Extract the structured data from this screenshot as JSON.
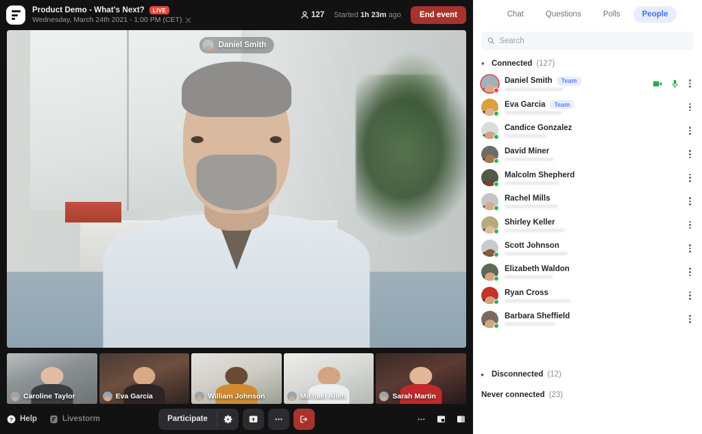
{
  "header": {
    "logo_icon": "livestorm-logo-icon",
    "event_title": "Product Demo - What's Next?",
    "live_badge": "LIVE",
    "event_date": "Wednesday, March 24th 2021 - 1:00 PM (CET)",
    "shuffle_icon": "shuffle-icon",
    "attendee_icon": "person-icon",
    "attendee_count": "127",
    "started_prefix": "Started",
    "started_duration": "1h 23m",
    "started_suffix": "ago",
    "end_event_label": "End event"
  },
  "stage": {
    "active_speaker": "Daniel Smith",
    "thumbnails": [
      {
        "name": "Caroline Taylor"
      },
      {
        "name": "Eva Garcia"
      },
      {
        "name": "William Johnson"
      },
      {
        "name": "Michael Allen"
      },
      {
        "name": "Sarah Martin"
      }
    ]
  },
  "bottom_bar": {
    "help_label": "Help",
    "help_icon": "question-circle-icon",
    "brand_label": "Livestorm",
    "brand_icon": "livestorm-logo-icon",
    "participate_label": "Participate",
    "settings_icon": "gear-icon",
    "share_icon": "share-screen-icon",
    "more_icon": "more-horizontal-icon",
    "leave_icon": "leave-icon",
    "right_more_icon": "more-horizontal-icon",
    "pip_icon": "picture-in-picture-icon",
    "layout_icon": "layout-split-icon"
  },
  "panel": {
    "tabs": [
      {
        "label": "Chat",
        "active": false
      },
      {
        "label": "Questions",
        "active": false
      },
      {
        "label": "Polls",
        "active": false
      },
      {
        "label": "People",
        "active": true
      }
    ],
    "search": {
      "icon": "search-icon",
      "placeholder": "Search",
      "value": ""
    },
    "connected": {
      "caret_icon": "chevron-down-icon",
      "label": "Connected",
      "count": "(127)"
    },
    "people": [
      {
        "name": "Daniel Smith",
        "badge": "Team",
        "speaking": true,
        "camera_icon": "video-camera-icon",
        "mic_icon": "microphone-icon",
        "kebab_icon": "more-vertical-icon"
      },
      {
        "name": "Eva Garcia",
        "badge": "Team",
        "speaking": false,
        "kebab_icon": "more-vertical-icon"
      },
      {
        "name": "Candice Gonzalez",
        "badge": "",
        "speaking": false,
        "kebab_icon": "more-vertical-icon"
      },
      {
        "name": "David Miner",
        "badge": "",
        "speaking": false,
        "kebab_icon": "more-vertical-icon"
      },
      {
        "name": "Malcolm Shepherd",
        "badge": "",
        "speaking": false,
        "kebab_icon": "more-vertical-icon"
      },
      {
        "name": "Rachel Mills",
        "badge": "",
        "speaking": false,
        "kebab_icon": "more-vertical-icon"
      },
      {
        "name": "Shirley Keller",
        "badge": "",
        "speaking": false,
        "kebab_icon": "more-vertical-icon"
      },
      {
        "name": "Scott Johnson",
        "badge": "",
        "speaking": false,
        "kebab_icon": "more-vertical-icon"
      },
      {
        "name": "Elizabeth Waldon",
        "badge": "",
        "speaking": false,
        "kebab_icon": "more-vertical-icon"
      },
      {
        "name": "Ryan Cross",
        "badge": "",
        "speaking": false,
        "kebab_icon": "more-vertical-icon"
      },
      {
        "name": "Barbara Sheffield",
        "badge": "",
        "speaking": false,
        "kebab_icon": "more-vertical-icon"
      }
    ],
    "disconnected": {
      "caret_icon": "chevron-right-icon",
      "label": "Disconnected",
      "count": "(12)"
    },
    "never_connected": {
      "label": "Never connected",
      "count": "(23)"
    }
  },
  "colors": {
    "accent_blue": "#3b6ef5",
    "live_red": "#e8453c",
    "end_event_red": "#a8332c",
    "online_green": "#2fb457",
    "dark_chrome": "#121213"
  }
}
